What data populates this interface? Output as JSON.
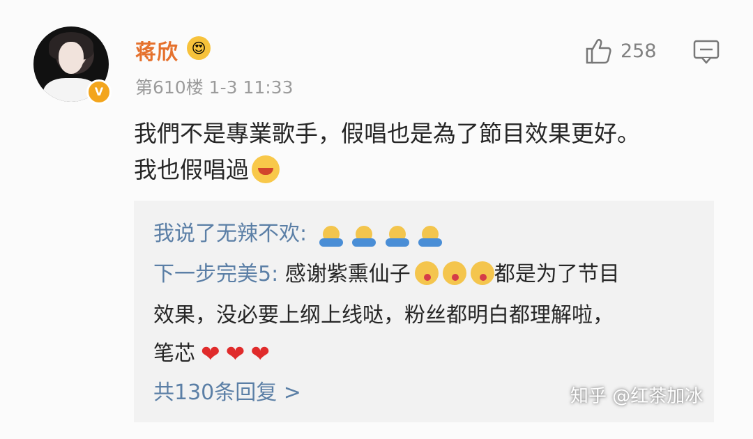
{
  "post": {
    "username": "蒋欣",
    "floor": "第610楼",
    "timestamp": "1-3 11:33",
    "like_count": "258",
    "content_line1": "我們不是專業歌手，假唱也是為了節目效果更好。",
    "content_line2": "我也假唱過"
  },
  "replies": {
    "reply1_name": "我说了无辣不欢:",
    "reply2_name": "下一步完美5:",
    "reply2_text_a": "感谢紫熏仙子",
    "reply2_text_b": "都是为了节目",
    "reply2_text_c": "效果，没必要上纲上线哒，粉丝都明白都理解啦，",
    "reply2_text_d": "笔芯",
    "more": "共130条回复 >"
  },
  "watermark": {
    "text": "知乎 @红茶加冰"
  },
  "icons": {
    "verified": "verified-badge",
    "user_emoji": "heart-eyes-emoji-icon",
    "like": "thumbs-up-icon",
    "comment": "comment-icon",
    "laugh": "laugh-emoji-icon",
    "pray": "pray-emoji-icon",
    "kiss": "kiss-emoji-icon",
    "heart": "heart-icon"
  },
  "colors": {
    "username": "#e5712d",
    "reply_name": "#5b7fa6",
    "meta": "#9b9b9b",
    "reply_bg": "#f2f2f2"
  }
}
